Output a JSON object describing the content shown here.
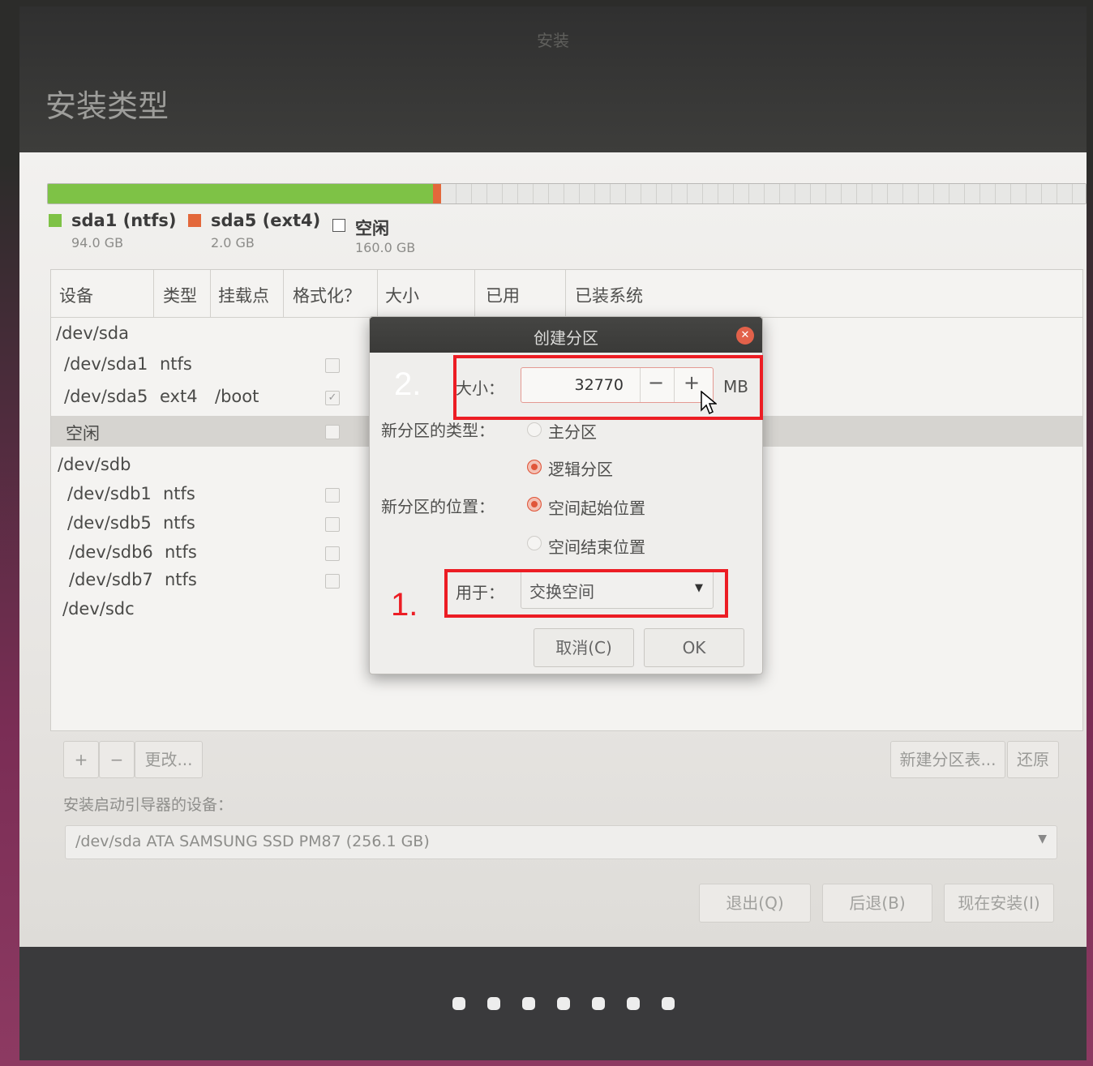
{
  "window": {
    "title": "安装",
    "page_title": "安装类型"
  },
  "disk_bar": {
    "segments": [
      {
        "name": "sda1 (ntfs)",
        "fraction": 0.3675,
        "color": "#7ec246"
      },
      {
        "name": "sda5 (ext4)",
        "fraction": 0.0078,
        "color": "#e3683b"
      },
      {
        "name": "空闲",
        "fraction": 0.6247,
        "color": "#e7e7e5"
      }
    ]
  },
  "legend": [
    {
      "name": "sda1 (ntfs)",
      "size": "94.0 GB"
    },
    {
      "name": "sda5 (ext4)",
      "size": "2.0 GB"
    },
    {
      "name": "空闲",
      "size": "160.0 GB"
    }
  ],
  "table": {
    "headers": [
      "设备",
      "类型",
      "挂载点",
      "格式化？",
      "大小",
      "已用",
      "已装系统"
    ],
    "rows": [
      {
        "device": "/dev/sda",
        "type": "",
        "mount": ""
      },
      {
        "device": "/dev/sda1",
        "type": "ntfs",
        "mount": ""
      },
      {
        "device": "/dev/sda5",
        "type": "ext4",
        "mount": "/boot"
      },
      {
        "device": "空闲",
        "type": "",
        "mount": ""
      },
      {
        "device": "/dev/sdb",
        "type": "",
        "mount": ""
      },
      {
        "device": "/dev/sdb1",
        "type": "ntfs",
        "mount": ""
      },
      {
        "device": "/dev/sdb5",
        "type": "ntfs",
        "mount": ""
      },
      {
        "device": "/dev/sdb6",
        "type": "ntfs",
        "mount": ""
      },
      {
        "device": "/dev/sdb7",
        "type": "ntfs",
        "mount": ""
      },
      {
        "device": "/dev/sdc",
        "type": "",
        "mount": ""
      }
    ]
  },
  "toolbar": {
    "add": "+",
    "remove": "−",
    "change": "更改...",
    "new_table": "新建分区表...",
    "revert": "还原"
  },
  "bootloader": {
    "label": "安装启动引导器的设备：",
    "value": "/dev/sda   ATA SAMSUNG SSD PM87 (256.1 GB)"
  },
  "nav": {
    "quit": "退出(Q)",
    "back": "后退(B)",
    "install": "现在安装(I)"
  },
  "dialog": {
    "title": "创建分区",
    "size_label": "大小：",
    "size_value": "32770",
    "size_unit": "MB",
    "minus": "−",
    "plus": "+",
    "type_label": "新分区的类型：",
    "type_primary": "主分区",
    "type_logical": "逻辑分区",
    "location_label": "新分区的位置：",
    "location_start": "空间起始位置",
    "location_end": "空间结束位置",
    "use_label": "用于：",
    "use_value": "交换空间",
    "cancel": "取消(C)",
    "ok": "OK"
  },
  "annotations": {
    "step1": "1.",
    "step2": "2."
  }
}
